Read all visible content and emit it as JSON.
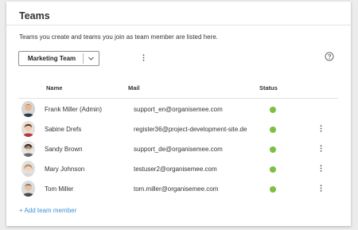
{
  "page": {
    "title": "Teams",
    "description": "Teams you create and teams you join as team member are listed here."
  },
  "team_select": {
    "selected": "Marketing Team",
    "chevron_icon": "chevron-down-icon"
  },
  "toolbar": {
    "more_icon": "vertical-ellipsis-icon",
    "help_icon": "question-circle-icon"
  },
  "table": {
    "columns": [
      "Name",
      "Mail",
      "Status"
    ],
    "status_color": "#7bc043",
    "rows": [
      {
        "name": "Frank Miller (Admin)",
        "mail": "support_en@organisemee.com",
        "has_menu": false
      },
      {
        "name": "Sabine Drefs",
        "mail": "register36@project-development-site.de",
        "has_menu": true
      },
      {
        "name": "Sandy Brown",
        "mail": "support_de@organisemee.com",
        "has_menu": true
      },
      {
        "name": "Mary Johnson",
        "mail": "testuser2@organisemee.com",
        "has_menu": true
      },
      {
        "name": "Tom Miller",
        "mail": "tom.miller@organisemee.com",
        "has_menu": true
      }
    ]
  },
  "add_member_label": "+ Add team member",
  "colors": {
    "accent_link": "#3a93d6",
    "status_online": "#7bc043"
  }
}
